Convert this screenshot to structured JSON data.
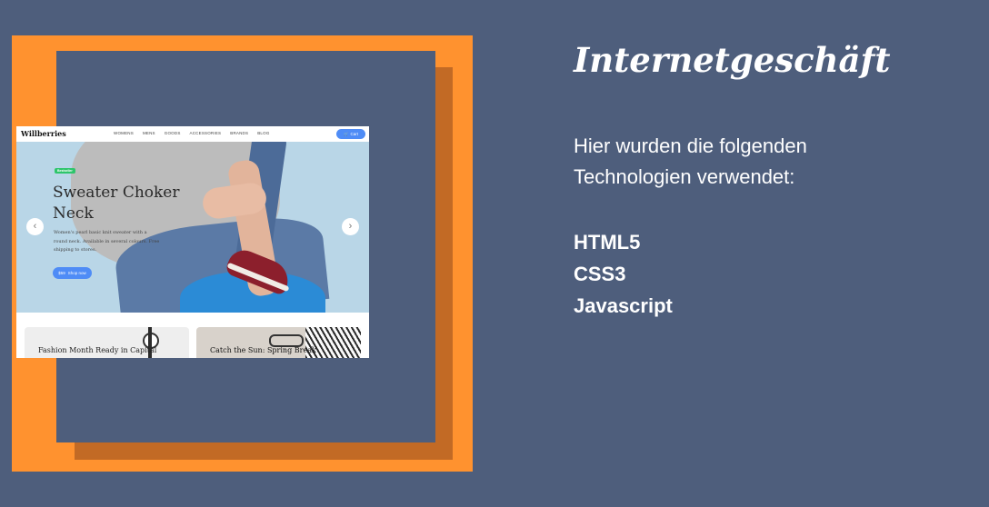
{
  "project": {
    "heading": "Internetgeschäft",
    "intro": "Hier wurden die folgenden Technologien verwendet:",
    "technologies": [
      "HTML5",
      "CSS3",
      "Javascript"
    ]
  },
  "colors": {
    "background": "#4e5e7c",
    "frame_accent": "#ff922f",
    "button_blue": "#4f8cf6",
    "badge_green": "#2ec56b"
  },
  "preview": {
    "logo": "Willberries",
    "nav": [
      "WOMENS",
      "MENS",
      "GOODS",
      "ACCESSORIES",
      "BRANDS",
      "BLOG"
    ],
    "cart_label": "Cart",
    "cart_icon": "cart-icon",
    "hero": {
      "badge": "Bestseller",
      "title": "Sweater Choker Neck",
      "description": "Women's pearl basic knit sweater with a round neck. Available in several colours. Free shipping to stores.",
      "price": "$59",
      "button": "Shop now",
      "prev_icon": "chevron-left-icon",
      "next_icon": "chevron-right-icon"
    },
    "cards": [
      "Fashion Month Ready in Capital",
      "Catch the Sun: Spring Break"
    ]
  }
}
